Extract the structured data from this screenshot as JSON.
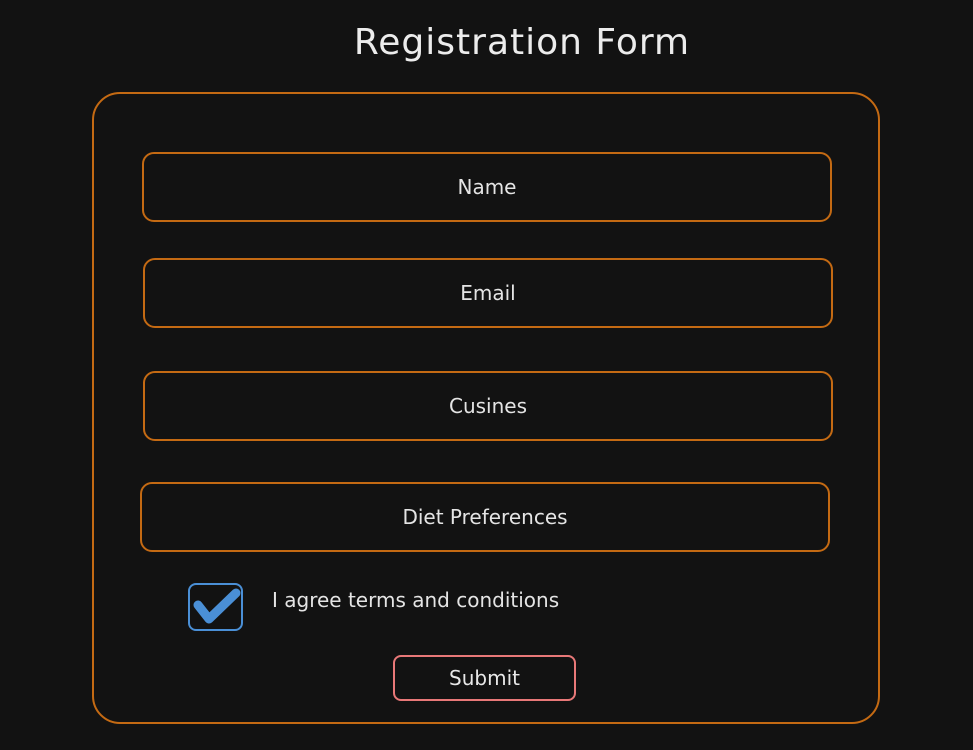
{
  "form": {
    "title": "Registration Form",
    "fields": [
      {
        "placeholder": "Name",
        "value": ""
      },
      {
        "placeholder": "Email",
        "value": ""
      },
      {
        "placeholder": "Cusines",
        "value": ""
      },
      {
        "placeholder": "Diet Preferences",
        "value": ""
      }
    ],
    "terms": {
      "label": "I agree terms and conditions",
      "checked": true
    },
    "submit_label": "Submit"
  },
  "colors": {
    "background": "#121212",
    "frame": "#c46a13",
    "checkbox": "#4a8fd6",
    "submit_border": "#e87878",
    "text": "#e4e4e4"
  }
}
